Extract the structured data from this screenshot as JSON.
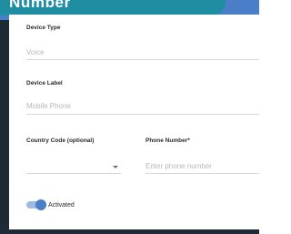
{
  "banner": {
    "title": "Number"
  },
  "form": {
    "device_type": {
      "label": "Device Type",
      "value": "Voice"
    },
    "device_label": {
      "label": "Device Label",
      "value": "Mobile Phone"
    },
    "country_code": {
      "label": "Country Code (optional)",
      "value": ""
    },
    "phone_number": {
      "label": "Phone Number*",
      "placeholder": "Enter phone number"
    },
    "activated": {
      "label": "Activated",
      "on": true
    }
  },
  "colors": {
    "banner": "#1f8ea3",
    "header": "#4a7ec9",
    "toggle_on": "#4a7ec9",
    "frame": "#1e2a36"
  }
}
